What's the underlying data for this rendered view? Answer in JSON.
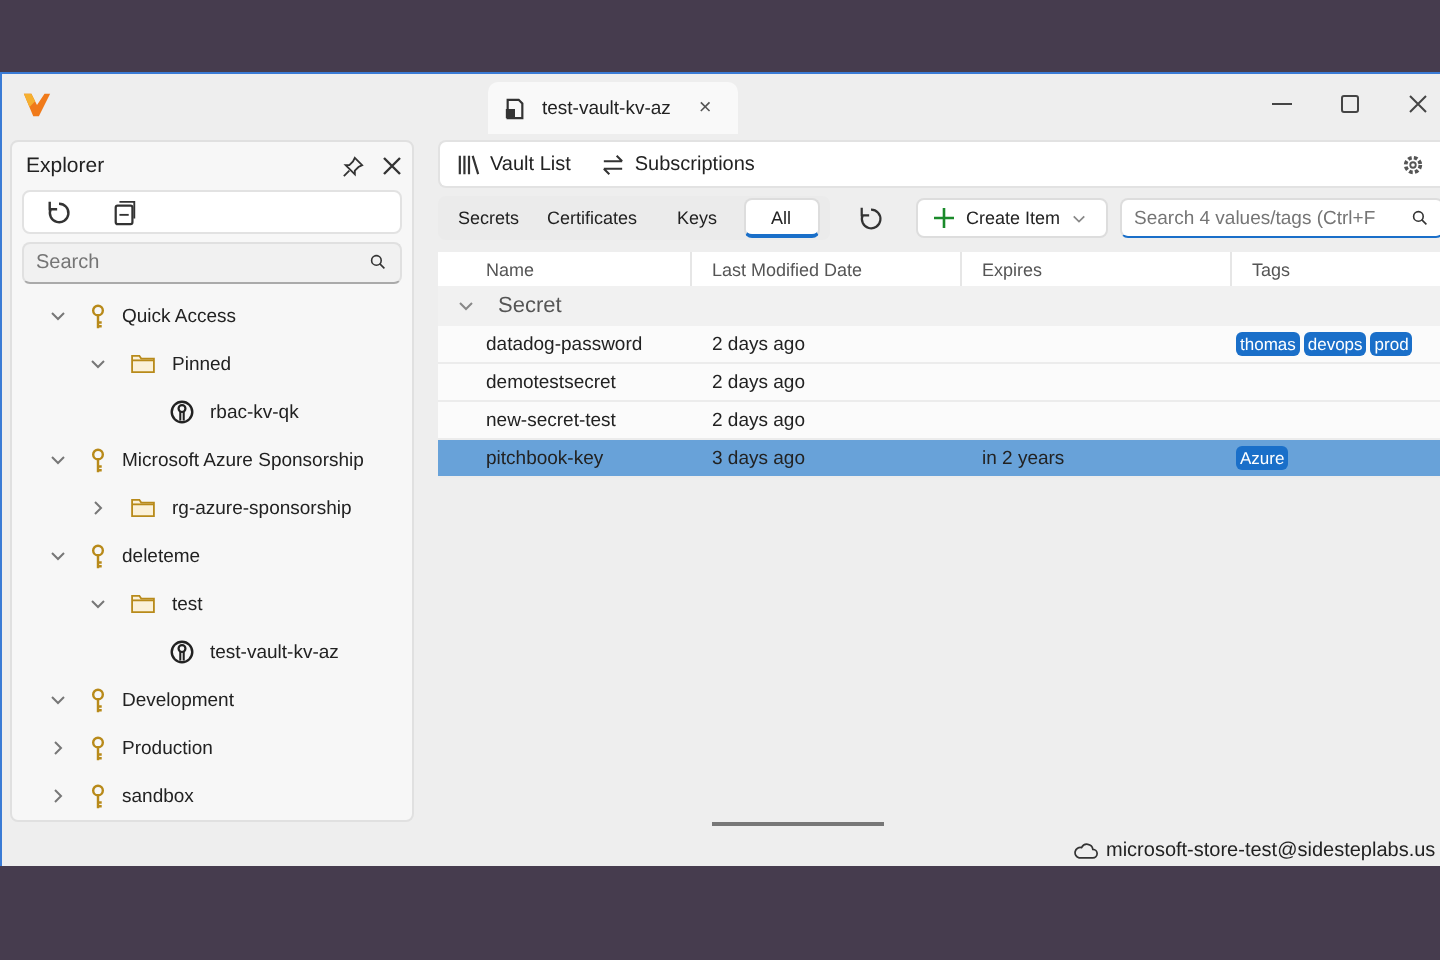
{
  "tab": {
    "title": "test-vault-kv-az",
    "close": "×"
  },
  "explorer": {
    "title": "Explorer",
    "search": {
      "placeholder": "Search"
    },
    "tree": [
      {
        "label": "Quick Access",
        "kind": "group",
        "expanded": true,
        "children": [
          {
            "label": "Pinned",
            "kind": "folder",
            "expanded": true,
            "children": [
              {
                "label": "rbac-kv-qk",
                "kind": "vault"
              }
            ]
          }
        ]
      },
      {
        "label": "Microsoft Azure Sponsorship",
        "kind": "group",
        "expanded": true,
        "children": [
          {
            "label": "rg-azure-sponsorship",
            "kind": "folder",
            "expanded": false
          }
        ]
      },
      {
        "label": "deleteme",
        "kind": "group",
        "expanded": true,
        "children": [
          {
            "label": "test",
            "kind": "folder",
            "expanded": true,
            "children": [
              {
                "label": "test-vault-kv-az",
                "kind": "vault"
              }
            ]
          }
        ]
      },
      {
        "label": "Development",
        "kind": "group",
        "expanded": true
      },
      {
        "label": "Production",
        "kind": "group",
        "expanded": false
      },
      {
        "label": "sandbox",
        "kind": "group",
        "expanded": false
      }
    ]
  },
  "toolbar": {
    "vault_list": "Vault List",
    "subscriptions": "Subscriptions"
  },
  "filters": [
    {
      "label": "Secrets",
      "selected": false
    },
    {
      "label": "Certificates",
      "selected": false
    },
    {
      "label": "Keys",
      "selected": false
    },
    {
      "label": "All",
      "selected": true
    }
  ],
  "create_button": "Create Item",
  "search": {
    "placeholder": "Search 4 values/tags (Ctrl+F"
  },
  "table": {
    "columns": [
      "Name",
      "Last Modified Date",
      "Expires",
      "Tags"
    ],
    "group": {
      "label": "Secret",
      "expanded": true
    },
    "rows": [
      {
        "name": "datadog-password",
        "modified": "2 days ago",
        "expires": "",
        "tags": [
          "thomas",
          "devops",
          "prod"
        ],
        "selected": false
      },
      {
        "name": "demotestsecret",
        "modified": "2 days ago",
        "expires": "",
        "tags": [],
        "selected": false
      },
      {
        "name": "new-secret-test",
        "modified": "2 days ago",
        "expires": "",
        "tags": [],
        "selected": false
      },
      {
        "name": "pitchbook-key",
        "modified": "3 days ago",
        "expires": "in 2 years",
        "tags": [
          "Azure"
        ],
        "selected": true
      }
    ]
  },
  "status_bar": {
    "account": "microsoft-store-test@sidesteplabs.us"
  }
}
